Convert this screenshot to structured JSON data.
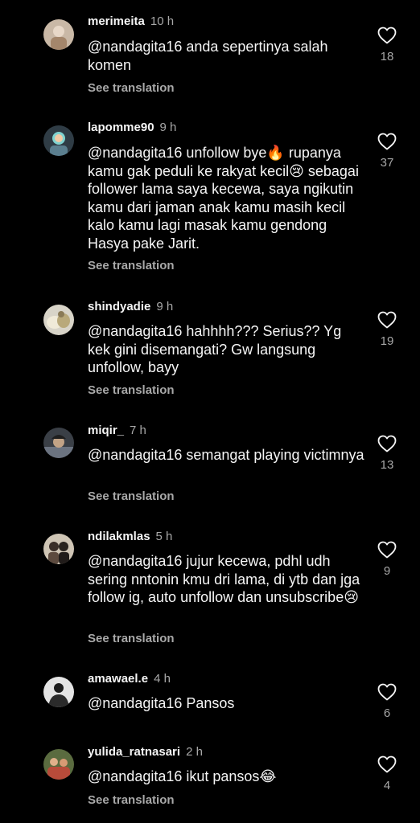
{
  "comments": [
    {
      "username": "merimeita",
      "time": "10 h",
      "text": "@nandagita16 anda sepertinya salah komen",
      "see_translation": "See translation",
      "likes": "18",
      "avatar_icon": "profile-photo-icon"
    },
    {
      "username": "lapomme90",
      "time": "9 h",
      "text": "@nandagita16 unfollow bye🔥 rupanya kamu gak peduli ke rakyat kecil😢 sebagai follower lama saya kecewa, saya ngikutin kamu dari jaman anak kamu masih kecil kalo kamu lagi masak kamu gendong Hasya pake Jarit.",
      "see_translation": "See translation",
      "likes": "37",
      "avatar_icon": "profile-photo-icon"
    },
    {
      "username": "shindyadie",
      "time": "9 h",
      "text": "@nandagita16 hahhhh??? Serius?? Yg kek gini disemangati? Gw langsung unfollow, bayy",
      "see_translation": "See translation",
      "likes": "19",
      "avatar_icon": "profile-photo-icon"
    },
    {
      "username": "miqir_",
      "time": "7 h",
      "text": "@nandagita16 semangat playing victimnya",
      "see_translation": "See translation",
      "likes": "13",
      "avatar_icon": "profile-photo-icon"
    },
    {
      "username": "ndilakmlas",
      "time": "5 h",
      "text": "@nandagita16  jujur kecewa, pdhl udh sering nntonin kmu dri lama, di ytb dan jga follow ig, auto unfollow dan unsubscribe😢",
      "see_translation": "See translation",
      "likes": "9",
      "avatar_icon": "profile-photo-icon"
    },
    {
      "username": "amawael.e",
      "time": "4 h",
      "text": "@nandagita16 Pansos",
      "see_translation": "",
      "likes": "6",
      "avatar_icon": "profile-photo-icon"
    },
    {
      "username": "yulida_ratnasari",
      "time": "2 h",
      "text": "@nandagita16 ikut pansos😂",
      "see_translation": "See translation",
      "likes": "4",
      "avatar_icon": "profile-photo-icon"
    }
  ],
  "icons": {
    "like": "heart-outline-icon"
  },
  "colors": {
    "background": "#000000",
    "primary_text": "#f5f5f5",
    "secondary_text": "#a8a8a8"
  }
}
